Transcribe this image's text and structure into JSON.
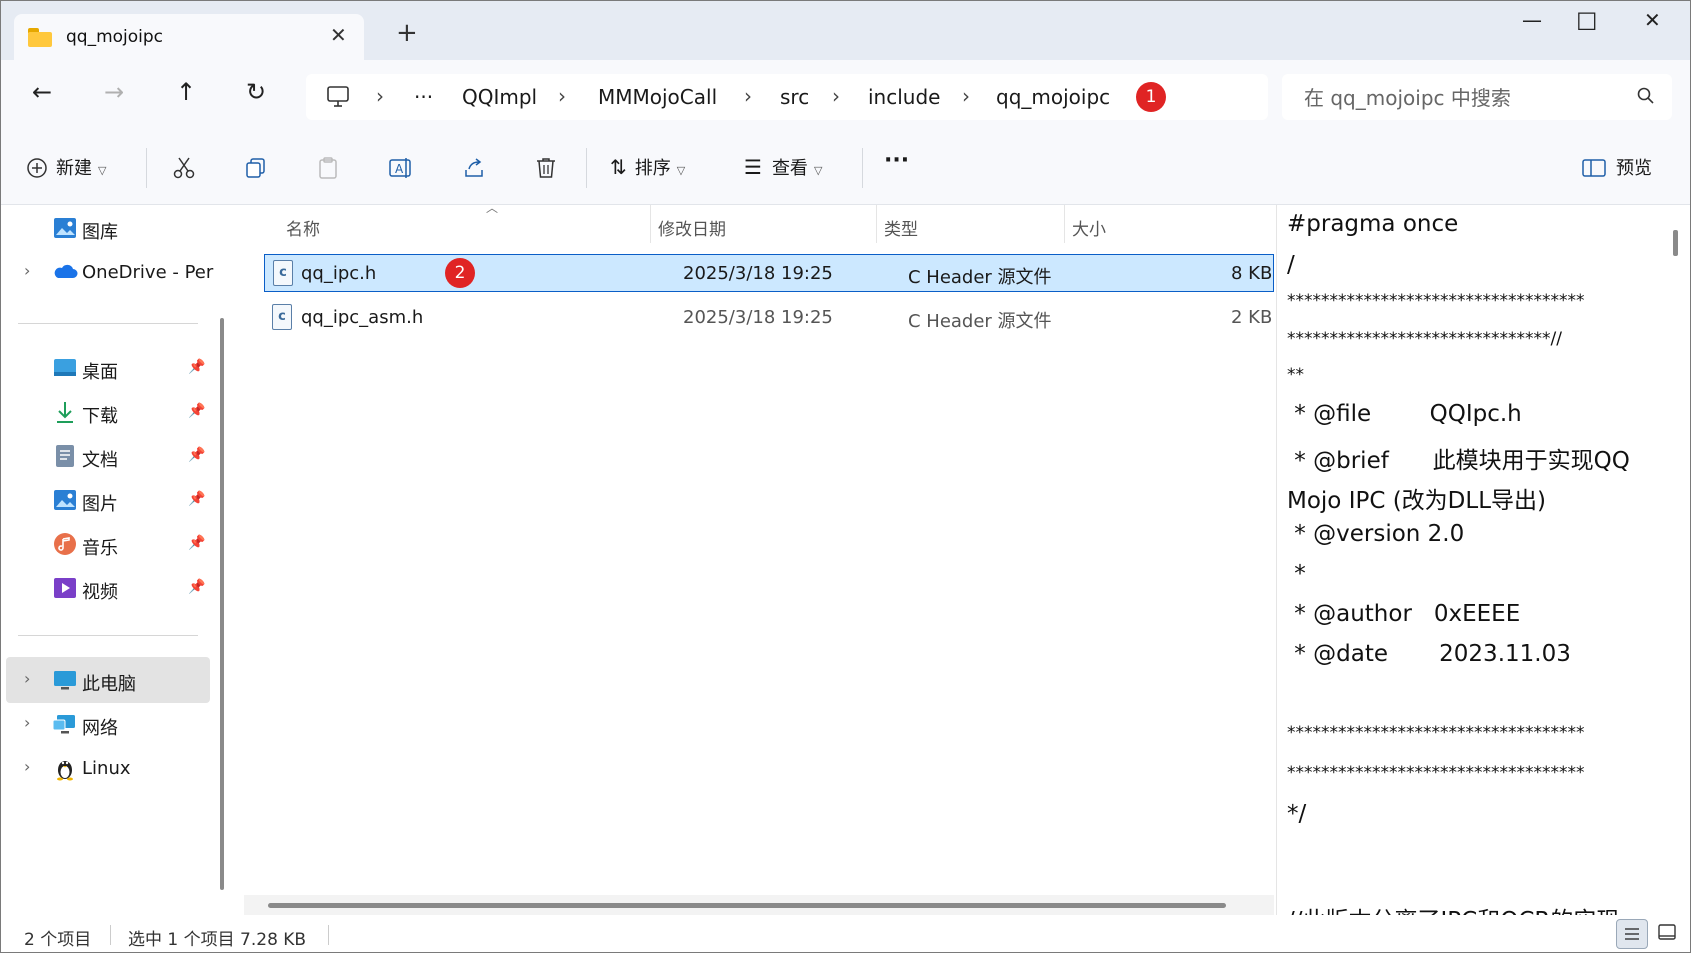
{
  "window": {
    "tab_title": "qq_mojoipc",
    "tab_close": "✕",
    "new_tab": "+",
    "minimize": "—",
    "maximize": "☐",
    "close": "✕"
  },
  "nav": {
    "back": "←",
    "forward": "→",
    "up": "↑",
    "refresh": "↻",
    "overflow": "···",
    "sep": "›",
    "breadcrumbs": [
      "QQImpl",
      "MMMojoCall",
      "src",
      "include",
      "qq_mojoipc"
    ],
    "badge1": "1",
    "search_placeholder": "在 qq_mojoipc 中搜索"
  },
  "toolbar": {
    "new_label": "新建",
    "sort_label": "排序",
    "view_label": "查看",
    "more_label": "···",
    "preview_label": "预览"
  },
  "sidebar": {
    "gallery": "图库",
    "onedrive": "OneDrive - Per",
    "desktop": "桌面",
    "downloads": "下载",
    "documents": "文档",
    "pictures": "图片",
    "music": "音乐",
    "videos": "视频",
    "thispc": "此电脑",
    "network": "网络",
    "linux": "Linux",
    "chev": "›",
    "pin": "📌"
  },
  "filelist": {
    "columns": [
      "名称",
      "修改日期",
      "类型",
      "大小"
    ],
    "badge2": "2",
    "rows": [
      {
        "name": "qq_ipc.h",
        "modified": "2025/3/18 19:25",
        "type": "C Header 源文件",
        "size": "8 KB"
      },
      {
        "name": "qq_ipc_asm.h",
        "modified": "2025/3/18 19:25",
        "type": "C Header 源文件",
        "size": "2 KB"
      }
    ],
    "file_icon_letter": "c"
  },
  "preview": {
    "lines": [
      "#pragma once",
      "/",
      "***********************************",
      "*******************************//",
      "**",
      " * @file        QQIpc.h",
      " * @brief      此模块用于实现QQ",
      "Mojo IPC (改为DLL导出)",
      " * @version 2.0",
      " *",
      " * @author   0xEEEE",
      " * @date       2023.11.03",
      "",
      "***********************************",
      "***********************************",
      "*/",
      "",
      "//此版本分离了IPC和OCR的实现"
    ]
  },
  "status": {
    "count": "2 个项目",
    "selected": "选中 1 个项目  7.28 KB"
  },
  "colors": {
    "accent": "#0a5ec7",
    "selection": "#cce8ff",
    "badge": "#e02424"
  }
}
